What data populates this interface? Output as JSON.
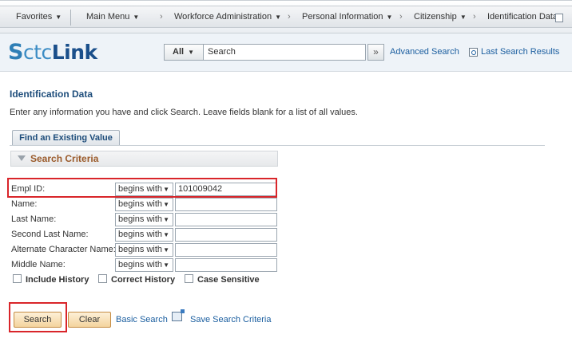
{
  "nav": {
    "favorites": "Favorites",
    "main_menu": "Main Menu",
    "items": [
      "Workforce Administration",
      "Personal Information",
      "Citizenship",
      "Identification Data"
    ]
  },
  "header": {
    "logo_s": "S",
    "logo_ctc": "ctc",
    "logo_link": "Link",
    "scope": "All",
    "search_placeholder": "Search",
    "go_label": "»",
    "advanced_search": "Advanced Search",
    "last_search_results": "Last Search Results"
  },
  "page": {
    "title": "Identification Data",
    "instructions": "Enter any information you have and click Search. Leave fields blank for a list of all values.",
    "tab": "Find an Existing Value",
    "criteria_title": "Search Criteria"
  },
  "fields": [
    {
      "label": "Empl ID:",
      "operator": "begins with",
      "value": "101009042"
    },
    {
      "label": "Name:",
      "operator": "begins with",
      "value": ""
    },
    {
      "label": "Last Name:",
      "operator": "begins with",
      "value": ""
    },
    {
      "label": "Second Last Name:",
      "operator": "begins with",
      "value": ""
    },
    {
      "label": "Alternate Character Name:",
      "operator": "begins with",
      "value": ""
    },
    {
      "label": "Middle Name:",
      "operator": "begins with",
      "value": ""
    }
  ],
  "options": {
    "include_history": "Include History",
    "correct_history": "Correct History",
    "case_sensitive": "Case Sensitive"
  },
  "actions": {
    "search": "Search",
    "clear": "Clear",
    "basic_search": "Basic Search",
    "save_search_criteria": "Save Search Criteria"
  },
  "colors": {
    "highlight": "#d9252a",
    "link": "#1c5fa0",
    "button": "#f4d49d"
  }
}
